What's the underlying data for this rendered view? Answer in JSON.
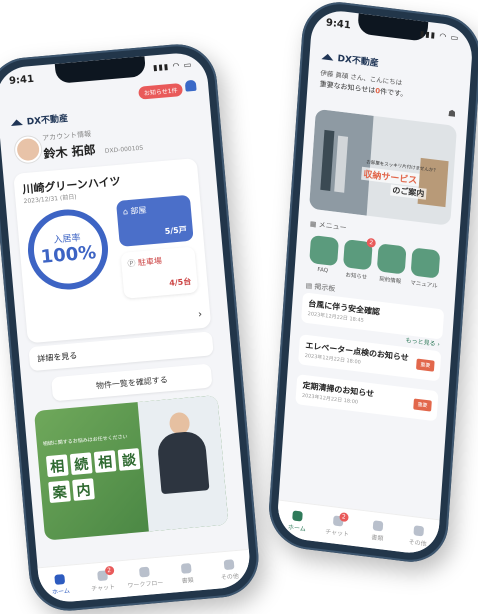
{
  "left": {
    "status_time": "9:41",
    "brand": "DX不動産",
    "notice_pill": "お知らせ1件",
    "account": {
      "label": "アカウント情報",
      "name": "鈴木 拓郎",
      "id": "DXD-00010S"
    },
    "property": {
      "name": "川崎グリーンハイツ",
      "date": "2023/12/31 (前日)"
    },
    "occupancy": {
      "label": "入居率",
      "value": "100%"
    },
    "rooms": {
      "label": "部屋",
      "value": "5/5戸"
    },
    "parking": {
      "label": "駐車場",
      "value": "4/5台"
    },
    "details_button": "詳細を見る",
    "list_button": "物件一覧を確認する",
    "banner": {
      "small": "相続に関するお悩みはお任せください",
      "chars": [
        "相",
        "続",
        "相",
        "談",
        "案",
        "内"
      ]
    },
    "tabs": [
      {
        "label": "ホーム",
        "active": true
      },
      {
        "label": "チャット",
        "badge": "2"
      },
      {
        "label": "ワークフロー"
      },
      {
        "label": "書類"
      },
      {
        "label": "その他"
      }
    ]
  },
  "right": {
    "status_time": "9:41",
    "brand": "DX不動産",
    "greeting": "伊藤 眞碩 さん、こんにちは",
    "unread_text": "重要なお知らせは",
    "unread_count": "0",
    "unread_suffix": "件です。",
    "banner": {
      "small": "お部屋をスッキリ片付けませんか?",
      "title1": "収納サービス",
      "title2": "のご案内"
    },
    "menu_title": "メニュー",
    "menu": [
      {
        "label": "FAQ"
      },
      {
        "label": "お知らせ",
        "badge": "2"
      },
      {
        "label": "契約情報"
      },
      {
        "label": "マニュアル"
      }
    ],
    "board_title": "掲示板",
    "more": "もっと見る",
    "news": [
      {
        "title": "台風に伴う安全確認",
        "date": "2023年12月22日 18:45",
        "tag": "重要"
      },
      {
        "title": "エレベーター点検のお知らせ",
        "date": "2023年12月22日 18:00",
        "tag": "重要"
      },
      {
        "title": "定期清掃のお知らせ",
        "date": "2023年12月22日 18:00",
        "tag": "重要"
      }
    ],
    "tabs": [
      {
        "label": "ホーム",
        "active": true
      },
      {
        "label": "チャット",
        "badge": "2"
      },
      {
        "label": "書類"
      },
      {
        "label": "その他"
      }
    ]
  }
}
